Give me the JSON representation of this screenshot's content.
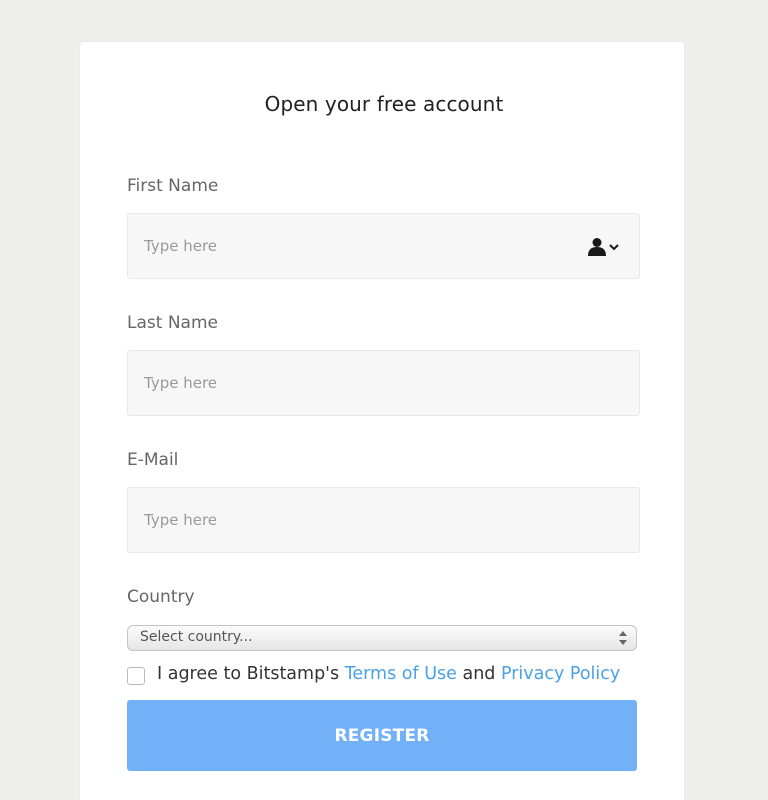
{
  "form": {
    "title": "Open your free account",
    "fields": [
      {
        "label": "First Name",
        "placeholder": "Type here"
      },
      {
        "label": "Last Name",
        "placeholder": "Type here"
      },
      {
        "label": "E-Mail",
        "placeholder": "Type here"
      }
    ],
    "country": {
      "label": "Country",
      "selected": "Select country..."
    },
    "agreement": {
      "prefix": "I agree to Bitstamp's ",
      "terms_link": "Terms of Use",
      "middle": " and ",
      "privacy_link": "Privacy Policy"
    },
    "register_label": "REGISTER"
  },
  "icons": {
    "autofill": "contact-autofill-icon"
  },
  "colors": {
    "background": "#eeeeea",
    "card": "#ffffff",
    "link": "#4aa1e8",
    "button": "#72b0f7",
    "field": "#f7f7f7"
  }
}
